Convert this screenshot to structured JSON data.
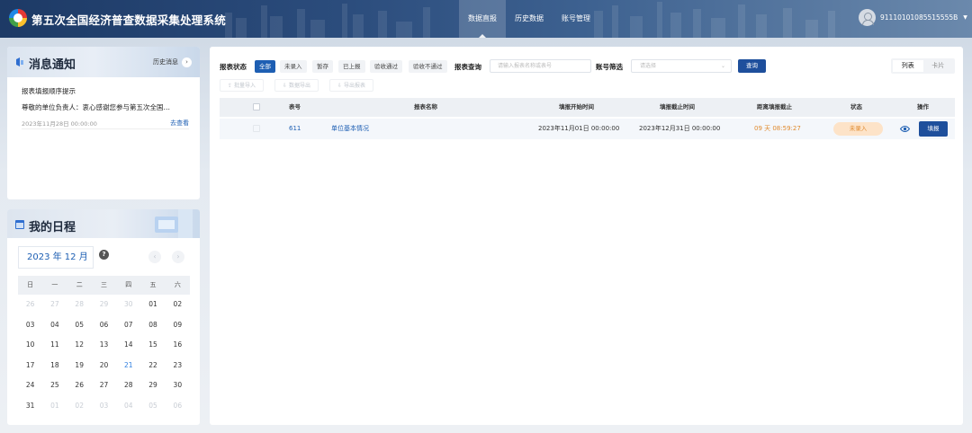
{
  "header": {
    "title": "第五次全国经济普查数据采集处理系统",
    "nav": [
      {
        "label": "数据直报",
        "active": true
      },
      {
        "label": "历史数据",
        "active": false
      },
      {
        "label": "账号管理",
        "active": false
      }
    ],
    "user_id": "91110101085515555B"
  },
  "notice": {
    "title": "消息通知",
    "history_label": "历史消息",
    "item": {
      "title": "报表填报顺序提示",
      "body": "尊敬的单位负责人：衷心感谢您参与第五次全国…",
      "date": "2023年11月28日 00:00:00",
      "link": "去查看"
    }
  },
  "calendar": {
    "title": "我的日程",
    "month_label": "2023 年 12 月",
    "help": "?",
    "prev": "‹",
    "next": "›",
    "weekdays": [
      "日",
      "一",
      "二",
      "三",
      "四",
      "五",
      "六"
    ],
    "weeks": [
      [
        "26",
        "27",
        "28",
        "29",
        "30",
        "01",
        "02"
      ],
      [
        "03",
        "04",
        "05",
        "06",
        "07",
        "08",
        "09"
      ],
      [
        "10",
        "11",
        "12",
        "13",
        "14",
        "15",
        "16"
      ],
      [
        "17",
        "18",
        "19",
        "20",
        "21",
        "22",
        "23"
      ],
      [
        "24",
        "25",
        "26",
        "27",
        "28",
        "29",
        "30"
      ],
      [
        "31",
        "01",
        "02",
        "03",
        "04",
        "05",
        "06"
      ]
    ],
    "today": "21"
  },
  "filters": {
    "status_label": "报表状态",
    "status_chips": [
      "全部",
      "未录入",
      "暂存",
      "已上报",
      "验收通过",
      "验收不通过"
    ],
    "active_chip": "全部",
    "query_label": "报表查询",
    "query_placeholder": "请输入报表名称或表号",
    "account_label": "账号筛选",
    "account_placeholder": "请选择",
    "query_button": "查询",
    "view_list": "列表",
    "view_card": "卡片"
  },
  "actions": {
    "batch_import": "批量导入",
    "data_export": "数据导出",
    "export_report": "导出报表"
  },
  "table": {
    "columns": {
      "code": "表号",
      "name": "报表名称",
      "start": "填报开始时间",
      "end": "填报截止时间",
      "remaining": "距离填报截止",
      "status": "状态",
      "ops": "操作"
    },
    "rows": [
      {
        "code": "611",
        "name": "单位基本情况",
        "start": "2023年11月01日 00:00:00",
        "end": "2023年12月31日 00:00:00",
        "remaining": "09 天 08:59:27",
        "status": "未录入",
        "fill_button": "填报"
      }
    ]
  },
  "colors": {
    "primary": "#1e4f9c",
    "link": "#1e5fb3",
    "warning": "#e08a2e",
    "warning_bg": "#fde3c8"
  }
}
